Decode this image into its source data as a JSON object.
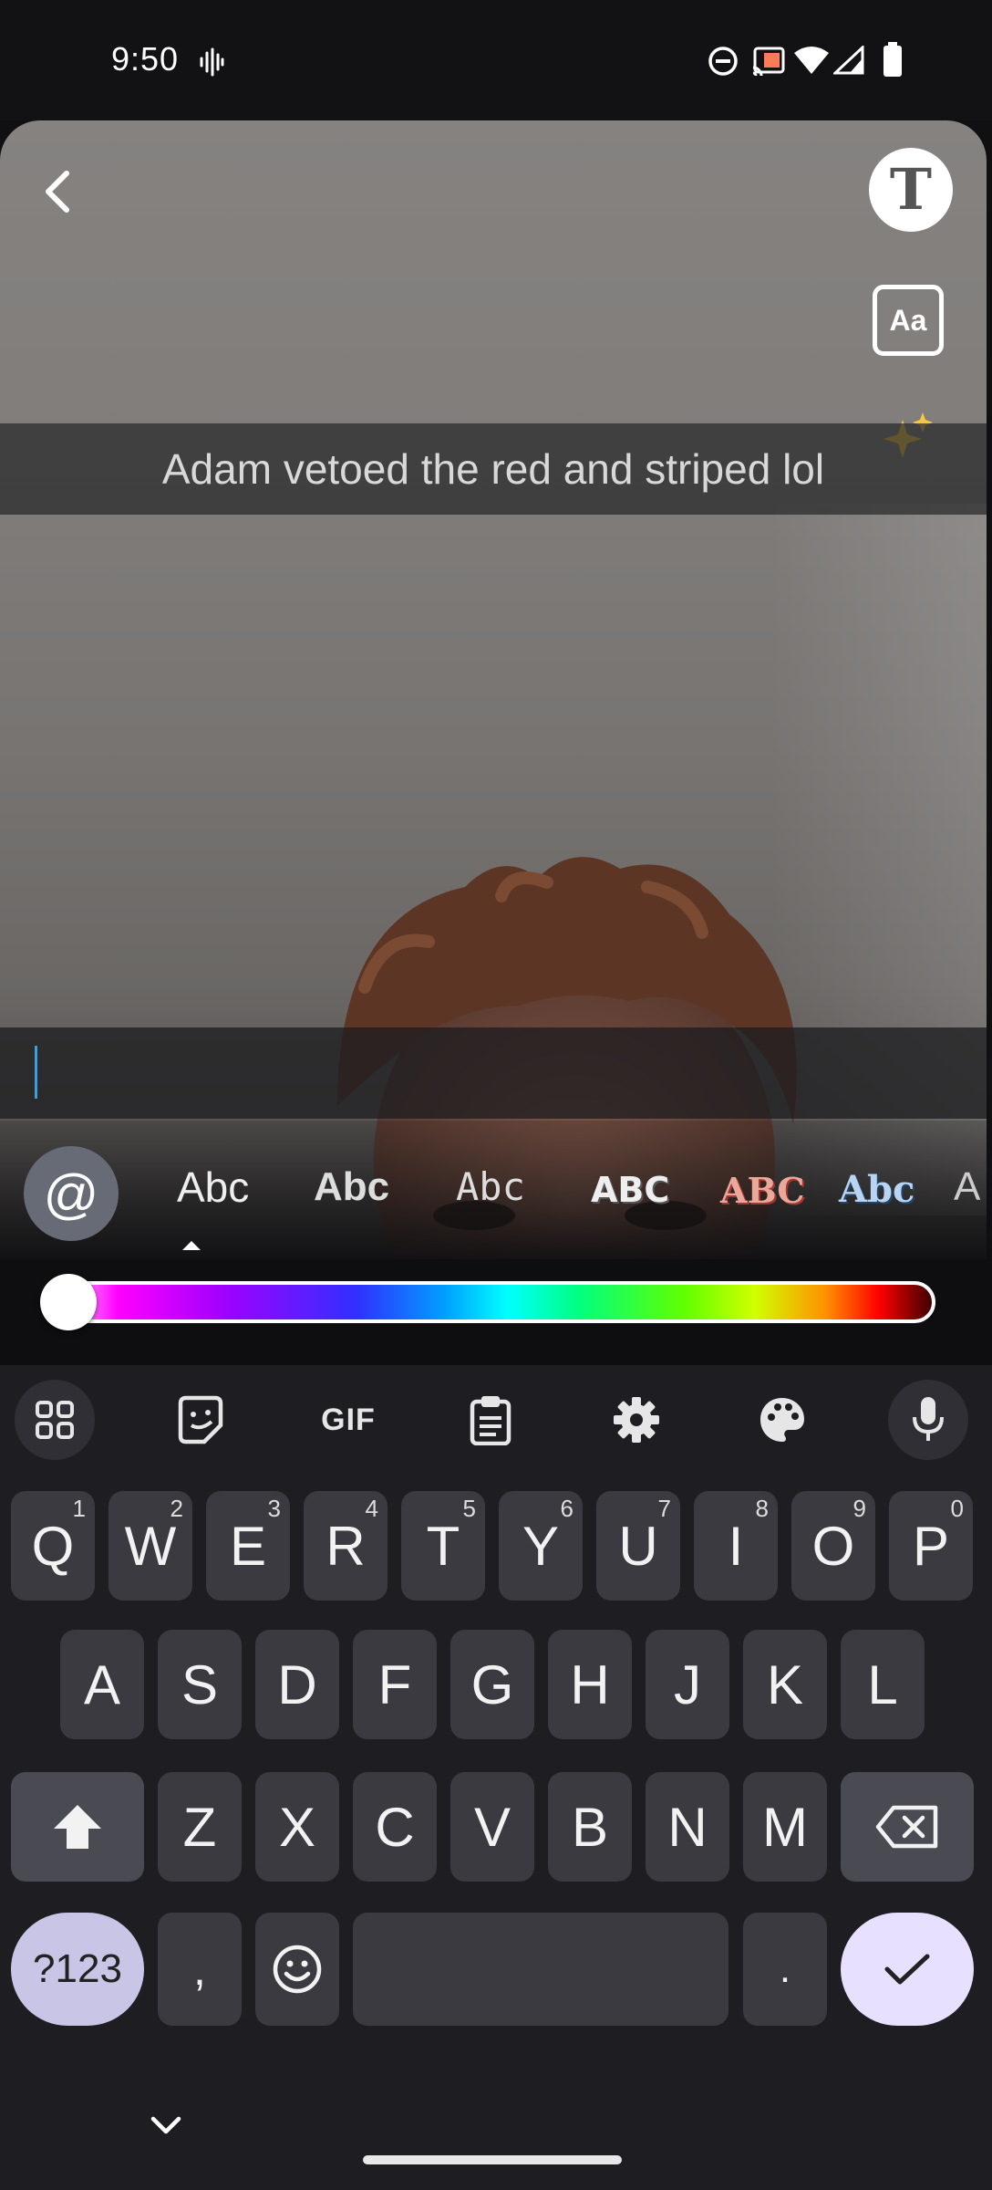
{
  "status_bar": {
    "time": "9:50",
    "icons": [
      "voice-activity-icon",
      "do-not-disturb-icon",
      "cast-icon",
      "wifi-icon",
      "cell-signal-icon",
      "battery-icon"
    ]
  },
  "editor": {
    "caption_text": "Adam vetoed the red and striped lol",
    "text_tool_label": "T",
    "font_tool_label": "Aa",
    "input_value": ""
  },
  "font_styles": {
    "mention_label": "@",
    "options": [
      "Abc",
      "Abc",
      "Abc",
      "ABC",
      "ABC",
      "Abc",
      "A"
    ],
    "selected_index": 0
  },
  "color_slider": {
    "selected_position": 0.0
  },
  "keyboard": {
    "toolbar": {
      "gif_label": "GIF"
    },
    "row1": [
      {
        "label": "Q",
        "hint": "1"
      },
      {
        "label": "W",
        "hint": "2"
      },
      {
        "label": "E",
        "hint": "3"
      },
      {
        "label": "R",
        "hint": "4"
      },
      {
        "label": "T",
        "hint": "5"
      },
      {
        "label": "Y",
        "hint": "6"
      },
      {
        "label": "U",
        "hint": "7"
      },
      {
        "label": "I",
        "hint": "8"
      },
      {
        "label": "O",
        "hint": "9"
      },
      {
        "label": "P",
        "hint": "0"
      }
    ],
    "row2": [
      "A",
      "S",
      "D",
      "F",
      "G",
      "H",
      "J",
      "K",
      "L"
    ],
    "row3": [
      "Z",
      "X",
      "C",
      "V",
      "B",
      "N",
      "M"
    ],
    "symbols_label": "?123",
    "comma_label": ",",
    "period_label": "."
  },
  "colors": {
    "keyboard_bg": "#1d1d22",
    "key_bg": "#3a3a40",
    "accent": "#e7e0ff",
    "cursor": "#3aa0e0"
  }
}
